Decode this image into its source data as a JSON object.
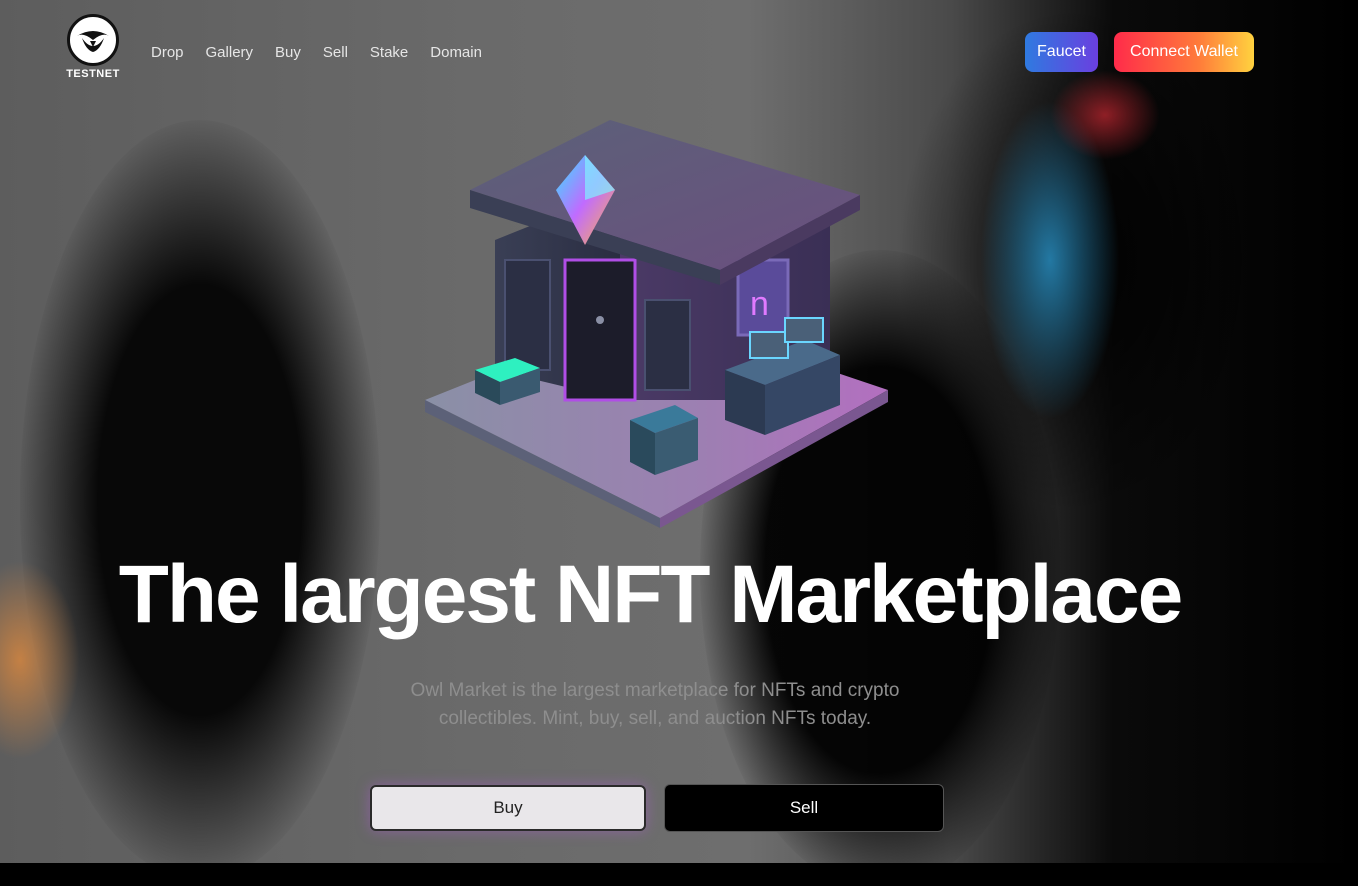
{
  "brand": {
    "badge": "TESTNET",
    "logo_icon": "owl-icon"
  },
  "nav": {
    "items": [
      {
        "label": "Drop"
      },
      {
        "label": "Gallery"
      },
      {
        "label": "Buy"
      },
      {
        "label": "Sell"
      },
      {
        "label": "Stake"
      },
      {
        "label": "Domain"
      }
    ]
  },
  "header": {
    "faucet_label": "Faucet",
    "connect_wallet_label": "Connect Wallet"
  },
  "hero": {
    "illustration": "nft-shop-house-icon",
    "title": "The largest NFT Marketplace",
    "subtitle": "Owl Market is the largest marketplace for NFTs and crypto collectibles. Mint, buy, sell, and auction NFTs today.",
    "buy_label": "Buy",
    "sell_label": "Sell"
  },
  "colors": {
    "faucet_gradient": [
      "#2f7ae0",
      "#6a3fe0"
    ],
    "wallet_gradient": [
      "#ff2b4a",
      "#ff7a3a",
      "#ffd23f"
    ],
    "page_background": "#000000",
    "subtitle_text": "#8e8e8e"
  }
}
